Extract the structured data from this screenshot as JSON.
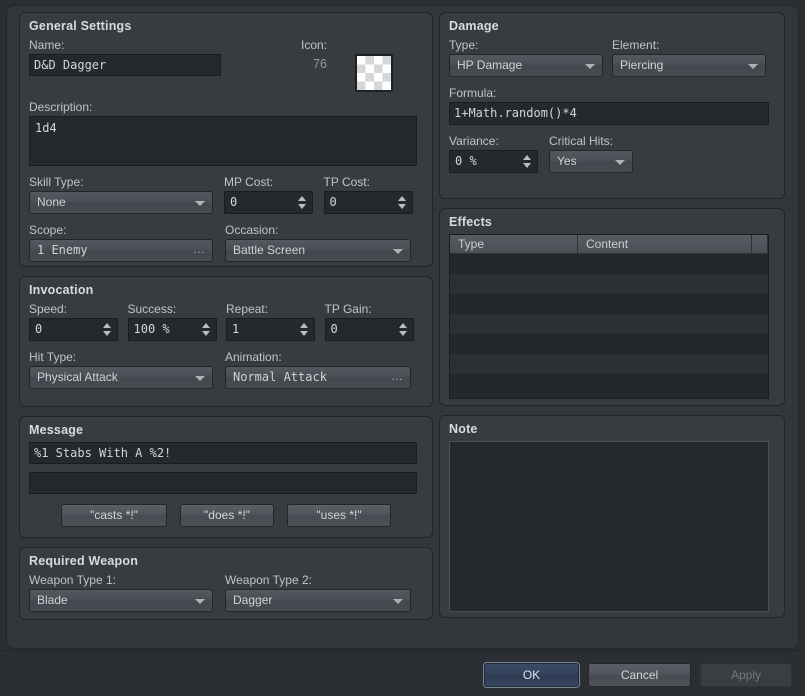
{
  "general": {
    "title": "General Settings",
    "name_label": "Name:",
    "name_value": "D&D Dagger",
    "icon_label": "Icon:",
    "icon_number": "76",
    "description_label": "Description:",
    "description_value": "1d4",
    "skill_type_label": "Skill Type:",
    "skill_type_value": "None",
    "mp_cost_label": "MP Cost:",
    "mp_cost_value": "0",
    "tp_cost_label": "TP Cost:",
    "tp_cost_value": "0",
    "scope_label": "Scope:",
    "scope_value": "1 Enemy",
    "occasion_label": "Occasion:",
    "occasion_value": "Battle Screen"
  },
  "invocation": {
    "title": "Invocation",
    "speed_label": "Speed:",
    "speed_value": "0",
    "success_label": "Success:",
    "success_value": "100 %",
    "repeat_label": "Repeat:",
    "repeat_value": "1",
    "tp_gain_label": "TP Gain:",
    "tp_gain_value": "0",
    "hit_type_label": "Hit Type:",
    "hit_type_value": "Physical Attack",
    "animation_label": "Animation:",
    "animation_value": "Normal Attack"
  },
  "message": {
    "title": "Message",
    "line1_value": "%1 Stabs With A %2!",
    "line2_value": "",
    "preset_buttons": [
      "\"casts *!\"",
      "\"does *!\"",
      "\"uses *!\""
    ]
  },
  "required_weapon": {
    "title": "Required Weapon",
    "weapon_type_1_label": "Weapon Type 1:",
    "weapon_type_1_value": "Blade",
    "weapon_type_2_label": "Weapon Type 2:",
    "weapon_type_2_value": "Dagger"
  },
  "damage": {
    "title": "Damage",
    "type_label": "Type:",
    "type_value": "HP Damage",
    "element_label": "Element:",
    "element_value": "Piercing",
    "formula_label": "Formula:",
    "formula_value": "1+Math.random()*4",
    "variance_label": "Variance:",
    "variance_value": "0 %",
    "critical_label": "Critical Hits:",
    "critical_value": "Yes"
  },
  "effects": {
    "title": "Effects",
    "columns": [
      "Type",
      "Content",
      ""
    ],
    "rows": []
  },
  "note": {
    "title": "Note",
    "value": ""
  },
  "footer": {
    "ok_label": "OK",
    "cancel_label": "Cancel",
    "apply_label": "Apply"
  }
}
